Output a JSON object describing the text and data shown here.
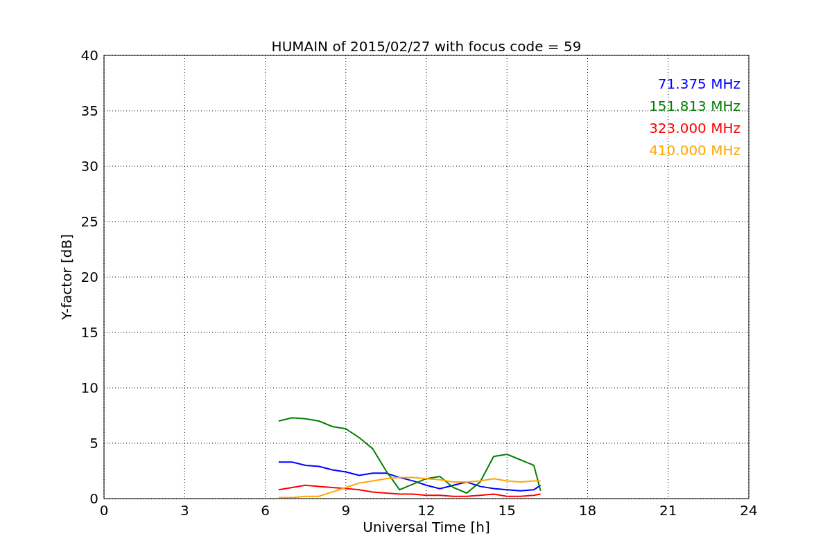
{
  "chart_data": {
    "type": "line",
    "title": "HUMAIN of 2015/02/27 with focus code = 59",
    "xlabel": "Universal Time [h]",
    "ylabel": "Y-factor [dB]",
    "x": [
      6.5,
      7,
      7.5,
      8,
      8.5,
      9,
      9.5,
      10,
      10.5,
      11,
      11.5,
      12,
      12.5,
      13,
      13.5,
      14,
      14.5,
      15,
      15.5,
      16,
      16.25
    ],
    "series": [
      {
        "name": "71.375 MHz",
        "color": "#0000ff",
        "values": [
          3.3,
          3.3,
          3.0,
          2.9,
          2.6,
          2.4,
          2.1,
          2.3,
          2.3,
          1.9,
          1.6,
          1.2,
          0.9,
          1.2,
          1.5,
          1.1,
          0.9,
          0.8,
          0.7,
          0.8,
          1.2
        ]
      },
      {
        "name": "151.813 MHz",
        "color": "#008000",
        "values": [
          7.0,
          7.3,
          7.2,
          7.0,
          6.5,
          6.3,
          5.5,
          4.5,
          2.5,
          0.8,
          1.3,
          1.8,
          2.0,
          1.0,
          0.5,
          1.5,
          3.8,
          4.0,
          3.5,
          3.0,
          0.7
        ]
      },
      {
        "name": "323.000 MHz",
        "color": "#ff0000",
        "values": [
          0.8,
          1.0,
          1.2,
          1.1,
          1.0,
          0.9,
          0.8,
          0.6,
          0.5,
          0.4,
          0.4,
          0.3,
          0.3,
          0.2,
          0.2,
          0.3,
          0.4,
          0.2,
          0.2,
          0.3,
          0.4
        ]
      },
      {
        "name": "410.000 MHz",
        "color": "#ffa500",
        "values": [
          0.1,
          0.1,
          0.2,
          0.2,
          0.6,
          1.0,
          1.4,
          1.6,
          1.8,
          1.9,
          1.9,
          1.8,
          1.7,
          1.5,
          1.5,
          1.6,
          1.8,
          1.6,
          1.5,
          1.6,
          1.6
        ]
      }
    ],
    "grid": true,
    "xlim": [
      0,
      24
    ],
    "ylim": [
      0,
      40
    ],
    "xticks": [
      0,
      3,
      6,
      9,
      12,
      15,
      18,
      21,
      24
    ],
    "yticks": [
      0,
      5,
      10,
      15,
      20,
      25,
      30,
      35,
      40
    ]
  }
}
